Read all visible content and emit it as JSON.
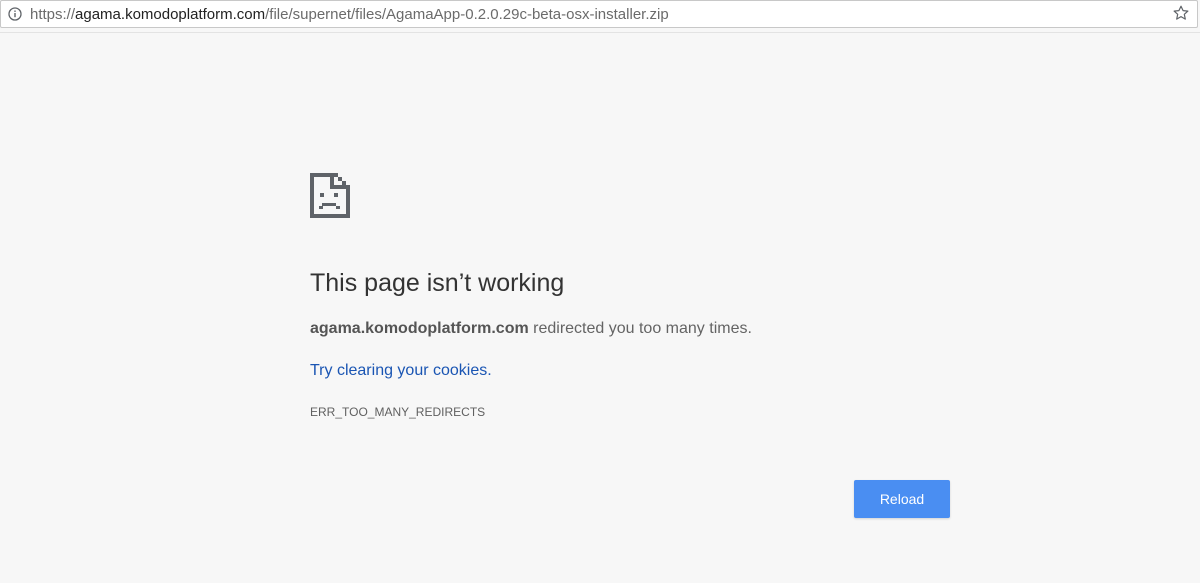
{
  "address_bar": {
    "url_host": "agama.komodoplatform.com",
    "url_prefix": "https://",
    "url_path": "/file/supernet/files/AgamaApp-0.2.0.29c-beta-osx-installer.zip",
    "info_icon": "info-circle-icon",
    "bookmark_icon": "star-icon"
  },
  "error_page": {
    "icon": "sad-page-icon",
    "title": "This page isn’t working",
    "description_host": "agama.komodoplatform.com",
    "description_text": " redirected you too many times.",
    "suggestion_link": "Try clearing your cookies.",
    "error_code": "ERR_TOO_MANY_REDIRECTS",
    "reload_label": "Reload"
  },
  "colors": {
    "background": "#f7f7f7",
    "link": "#1a55b3",
    "button": "#4a8ef2",
    "icon": "#5f6368"
  }
}
